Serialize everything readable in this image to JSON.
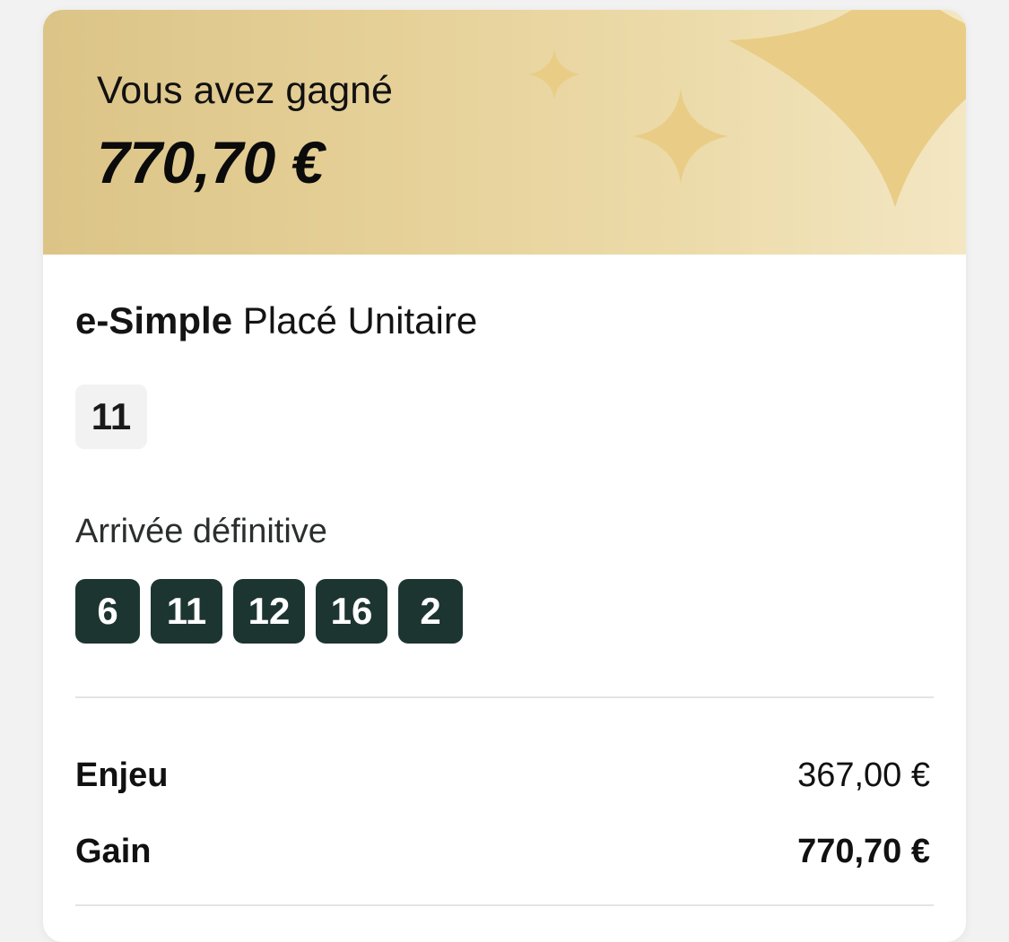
{
  "banner": {
    "title": "Vous avez gagné",
    "amount": "770,70 €",
    "colors": {
      "gold_light": "#f3e6c2",
      "gold_dark": "#dcc487",
      "sparkle": "#e9cd86"
    }
  },
  "bet": {
    "type_strong": "e-Simple",
    "type_rest": "Placé Unitaire",
    "selection": "11"
  },
  "arrival": {
    "label": "Arrivée définitive",
    "numbers": [
      "6",
      "11",
      "12",
      "16",
      "2"
    ],
    "chip_color": "#1d3531"
  },
  "summary": {
    "stake_label": "Enjeu",
    "stake_value": "367,00 €",
    "gain_label": "Gain",
    "gain_value": "770,70 €"
  }
}
